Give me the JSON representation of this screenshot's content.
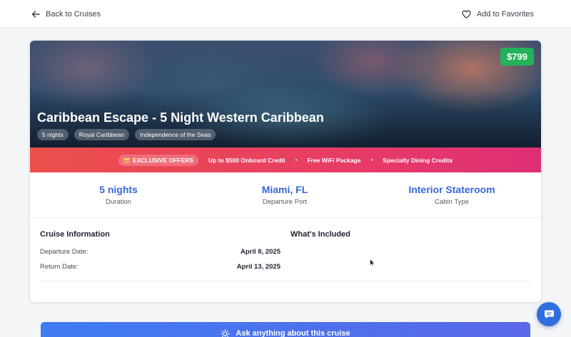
{
  "header": {
    "back_label": "Back to Cruises",
    "favorite_label": "Add to Favorites"
  },
  "hero": {
    "price": "$799",
    "title": "Caribbean Escape - 5 Night Western Caribbean",
    "tags": [
      "5 nights",
      "Royal Caribbean",
      "Independence of the Seas"
    ]
  },
  "offers": {
    "badge": "EXCLUSIVE OFFERS",
    "items": [
      "Up to $500 Onboard Credit",
      "Free WiFi Package",
      "Specialty Dining Credits"
    ]
  },
  "stats": [
    {
      "value": "5 nights",
      "label": "Duration"
    },
    {
      "value": "Miami, FL",
      "label": "Departure Port"
    },
    {
      "value": "Interior Stateroom",
      "label": "Cabin Type"
    }
  ],
  "cruise_info": {
    "title": "Cruise Information",
    "rows": [
      {
        "label": "Departure Date:",
        "value": "April 8, 2025"
      },
      {
        "label": "Return Date:",
        "value": "April 13, 2025"
      }
    ]
  },
  "included": {
    "title": "What's Included"
  },
  "ask": {
    "label": "Ask anything about this cruise"
  },
  "colors": {
    "price_badge": "#22b25a",
    "stat_value": "#3767d6",
    "offers_start": "#ec4f4b",
    "offers_end": "#de2f76",
    "ask_bar": "#3f7cf0",
    "chat_fab": "#2f6fe0"
  },
  "icons": {
    "back": "arrow-left-icon",
    "favorite": "heart-icon",
    "offers": "gift-icon",
    "ask": "lightbulb-icon",
    "chat": "chat-bubble-icon"
  }
}
